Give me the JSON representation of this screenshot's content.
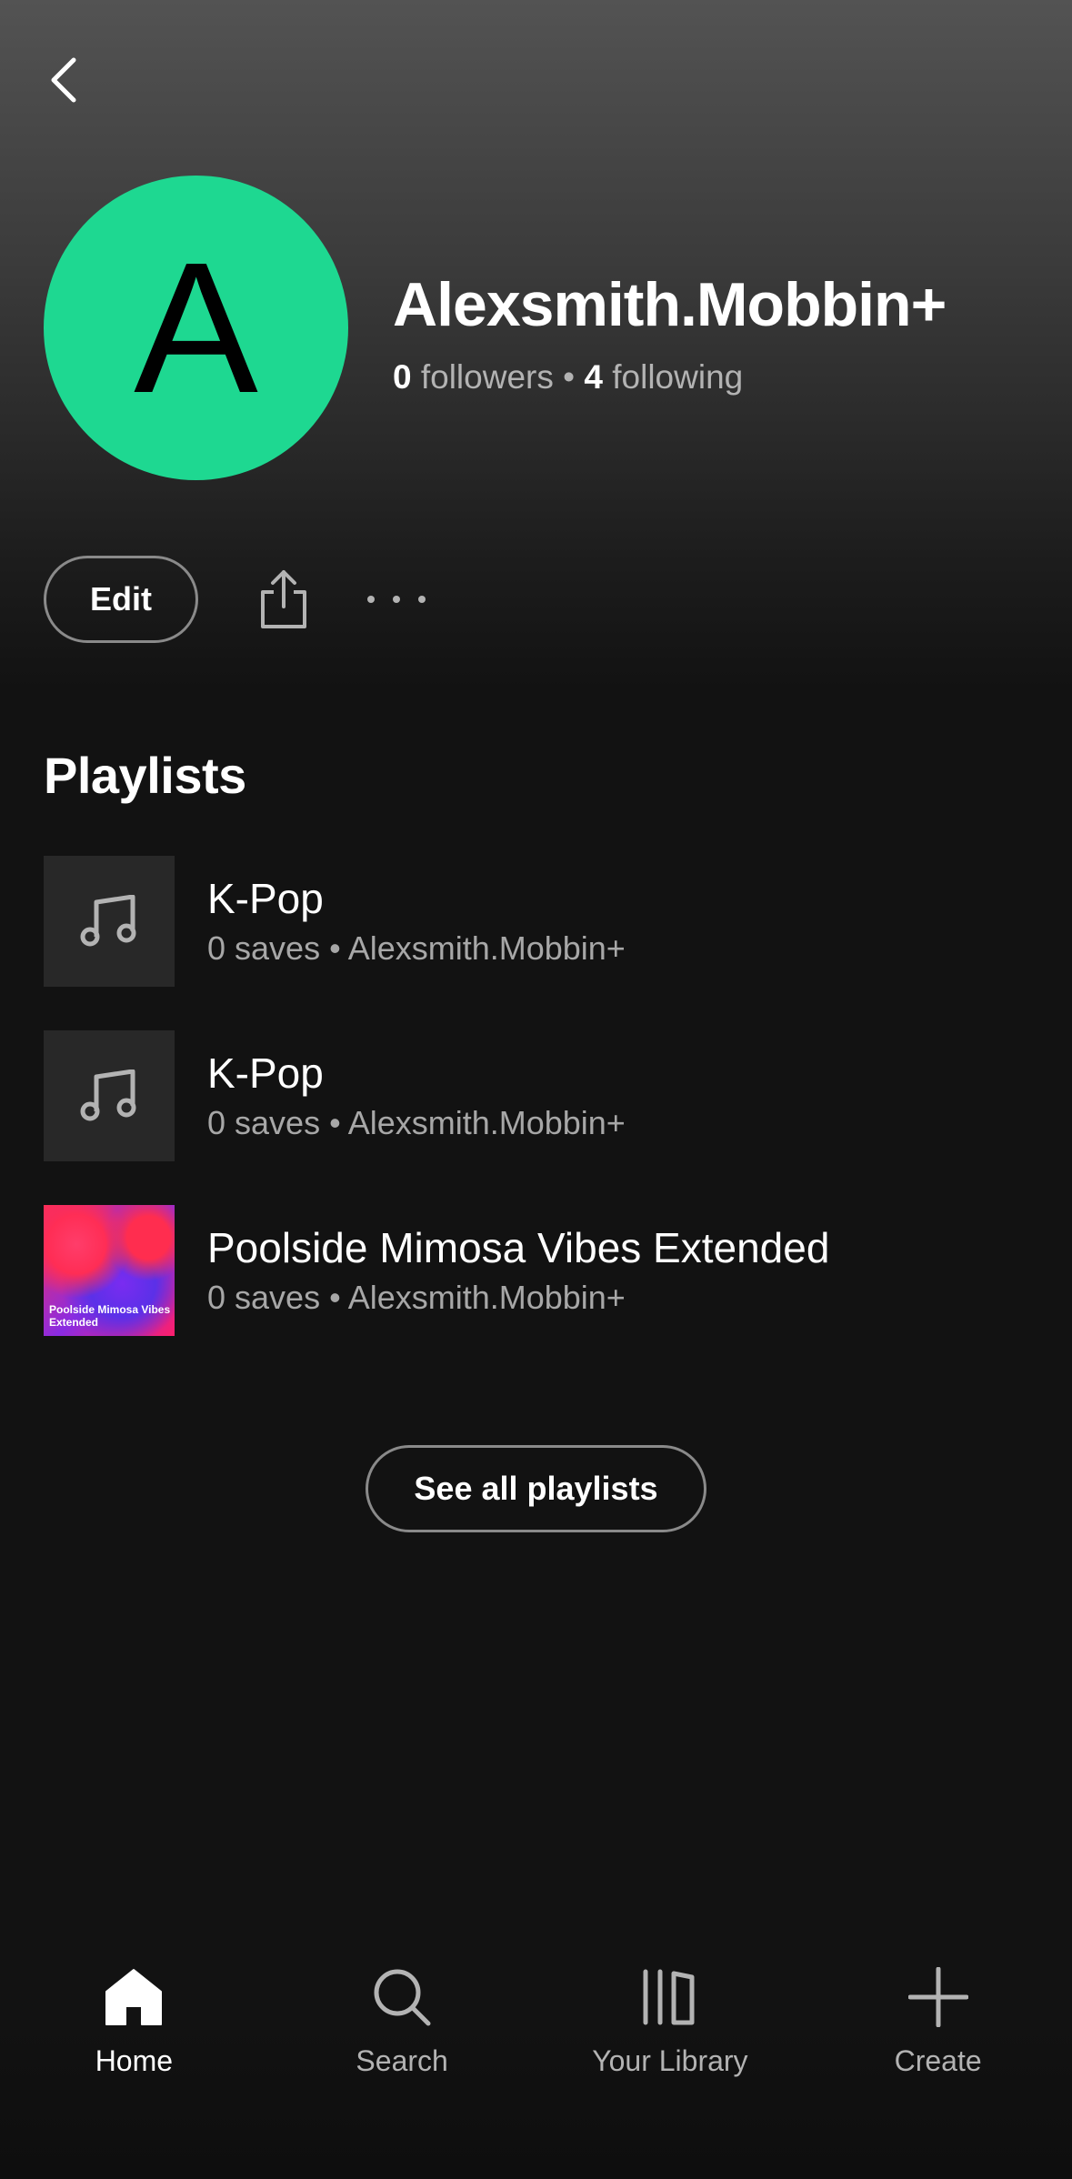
{
  "header": {
    "back_icon": "chevron-left-icon"
  },
  "profile": {
    "avatar_letter": "A",
    "avatar_color": "#1ed891",
    "name": "Alexsmith.Mobbin+",
    "followers_count": "0",
    "followers_label": "followers",
    "separator": "•",
    "following_count": "4",
    "following_label": "following"
  },
  "actions": {
    "edit_label": "Edit",
    "share_icon": "share-icon",
    "more_icon": "more-horizontal-icon"
  },
  "playlists": {
    "section_title": "Playlists",
    "items": [
      {
        "title": "K-Pop",
        "subtitle": "0 saves • Alexsmith.Mobbin+",
        "thumb": "music-note-icon"
      },
      {
        "title": "K-Pop",
        "subtitle": "0 saves • Alexsmith.Mobbin+",
        "thumb": "music-note-icon"
      },
      {
        "title": "Poolside Mimosa Vibes Extended",
        "subtitle": "0 saves • Alexsmith.Mobbin+",
        "thumb": "cover-art",
        "cover_text": "Poolside Mimosa Vibes Extended"
      }
    ],
    "see_all_label": "See all playlists"
  },
  "bottom_nav": {
    "items": [
      {
        "label": "Home",
        "icon": "home-icon",
        "active": true
      },
      {
        "label": "Search",
        "icon": "search-icon",
        "active": false
      },
      {
        "label": "Your Library",
        "icon": "library-icon",
        "active": false
      },
      {
        "label": "Create",
        "icon": "plus-icon",
        "active": false
      }
    ]
  },
  "colors": {
    "background": "#121212",
    "accent": "#1ed891",
    "secondary_text": "#b3b3b3"
  }
}
